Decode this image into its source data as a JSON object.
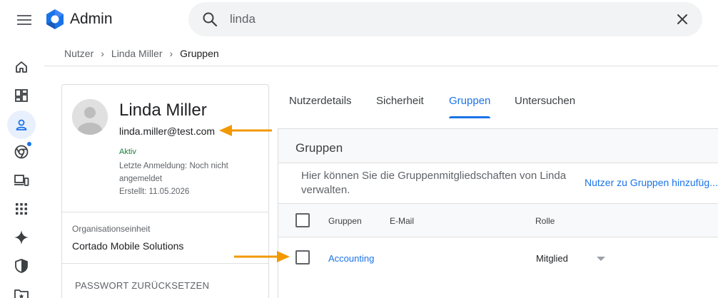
{
  "app": {
    "title": "Admin"
  },
  "search": {
    "value": "linda"
  },
  "breadcrumb": {
    "items": [
      "Nutzer",
      "Linda Miller",
      "Gruppen"
    ]
  },
  "rail": {
    "icons": [
      "home-icon",
      "dashboard-icon",
      "user-icon",
      "chrome-icon",
      "devices-icon",
      "apps-icon",
      "gemini-icon",
      "shield-icon",
      "folder-star-icon"
    ],
    "active": "user-icon"
  },
  "profile": {
    "name": "Linda Miller",
    "email": "linda.miller@test.com",
    "status": "Aktiv",
    "last_login": "Letzte Anmeldung: Noch nicht angemeldet",
    "created": "Erstellt: 11.05.2026",
    "org_label": "Organisationseinheit",
    "org_value": "Cortado Mobile Solutions",
    "reset_password": "PASSWORT ZURÜCKSETZEN"
  },
  "tabs": [
    {
      "label": "Nutzerdetails",
      "active": false
    },
    {
      "label": "Sicherheit",
      "active": false
    },
    {
      "label": "Gruppen",
      "active": true
    },
    {
      "label": "Untersuchen",
      "active": false
    }
  ],
  "groups": {
    "title": "Gruppen",
    "description": "Hier können Sie die Gruppenmitgliedschaften von Linda verwalten.",
    "add_link": "Nutzer zu Gruppen hinzufüg...",
    "columns": {
      "group": "Gruppen",
      "email": "E-Mail",
      "role": "Rolle"
    },
    "rows": [
      {
        "group": "Accounting",
        "email": "",
        "role": "Mitglied"
      }
    ]
  },
  "colors": {
    "accent": "#1a73e8",
    "arrow": "#f29900",
    "status": "#188038"
  }
}
